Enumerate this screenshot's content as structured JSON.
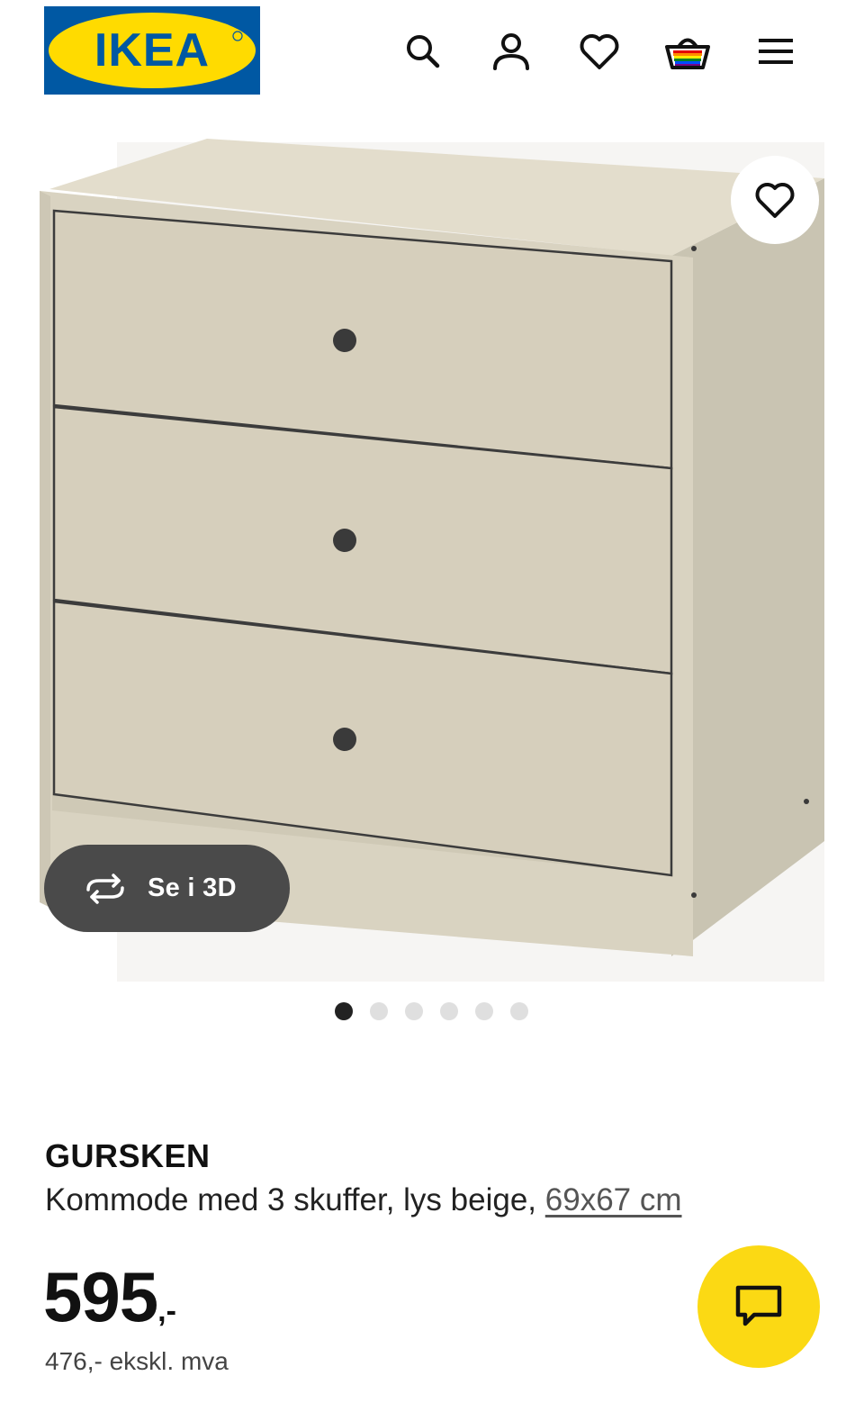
{
  "brand": {
    "logo_text": "IKEA",
    "logo_blue": "#0058a3",
    "logo_yellow": "#ffdb00"
  },
  "header": {
    "icons": [
      "search-icon",
      "account-icon",
      "heart-icon",
      "basket-icon",
      "menu-icon"
    ]
  },
  "hero": {
    "view3d_label": "Se i 3D",
    "carousel_total": 6,
    "carousel_active": 1,
    "product_color": "#dcd6c4"
  },
  "product": {
    "name": "GURSKEN",
    "description": "Kommode med 3 skuffer, lys beige,",
    "size": "69x67 cm",
    "price_main": "595",
    "price_suffix": ",-",
    "price_ex_vat": "476,- ekskl. mva"
  },
  "colors": {
    "accent_yellow": "#fbd914",
    "pill_bg": "#4a4a4a"
  }
}
